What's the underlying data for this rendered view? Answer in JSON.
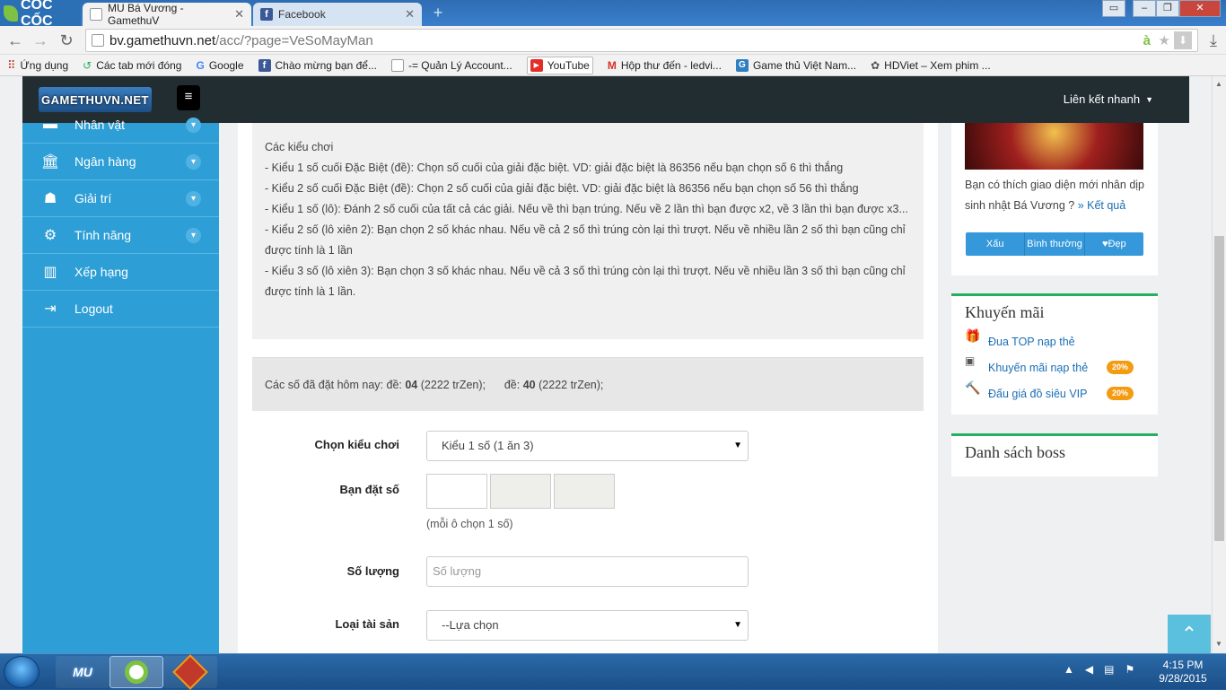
{
  "browser": {
    "brand": "CỐC CỐC",
    "tabs": [
      {
        "title": "MU Bá Vương - GamethuV",
        "active": true
      },
      {
        "title": "Facebook",
        "active": false
      }
    ],
    "url": {
      "host": "bv.gamethuvn.net",
      "path": "/acc/?page=VeSoMayMan"
    },
    "bookmarks": [
      {
        "label": "Ứng dụng",
        "icon": "apps-grid-icon"
      },
      {
        "label": "Các tab mới đóng",
        "icon": "recent-tabs-icon"
      },
      {
        "label": "Google",
        "icon": "google-icon"
      },
      {
        "label": "Chào mừng bạn để...",
        "icon": "facebook-icon"
      },
      {
        "label": "-= Quản Lý Account...",
        "icon": "page-icon"
      },
      {
        "label": "YouTube",
        "icon": "youtube-icon"
      },
      {
        "label": "Hộp thư đến - ledvi...",
        "icon": "gmail-icon"
      },
      {
        "label": "Game thủ Việt Nam...",
        "icon": "gamethu-icon"
      },
      {
        "label": "HDViet – Xem phim ...",
        "icon": "hdviet-icon"
      }
    ]
  },
  "site": {
    "logo": "GAMETHUVN.NET",
    "quick_links": "Liên kết nhanh",
    "sidebar": [
      {
        "label": "Nhân vật",
        "icon": "character-icon",
        "chevron": true
      },
      {
        "label": "Ngân hàng",
        "icon": "bank-icon",
        "chevron": true
      },
      {
        "label": "Giải trí",
        "icon": "android-icon",
        "chevron": true
      },
      {
        "label": "Tính năng",
        "icon": "cogs-icon",
        "chevron": true
      },
      {
        "label": "Xếp hạng",
        "icon": "bar-chart-icon",
        "chevron": false
      },
      {
        "label": "Logout",
        "icon": "logout-icon",
        "chevron": false
      }
    ],
    "rules": {
      "heading": "Các kiểu chơi",
      "lines": [
        "- Kiểu 1 số cuối Đặc Biệt (đề): Chọn số cuối của giải đặc biệt. VD: giải đặc biệt là 86356 nếu bạn chọn số 6 thì thắng",
        "- Kiểu 2 số cuối Đặc Biệt (đề): Chọn 2 số cuối của giải đặc biệt. VD: giải đặc biệt là 86356 nếu bạn chọn số 56 thì thắng",
        "- Kiểu 1 số (lô): Đánh 2 số cuối của tất cả các giải. Nếu về thì bạn trúng. Nếu về 2 lần thì bạn được x2, về 3 lần thì bạn được x3...",
        "- Kiểu 2 số (lô xiên 2): Bạn chọn 2 số khác nhau. Nếu về cả 2 số thì trúng còn lại thì trượt. Nếu về nhiều lần 2 số thì bạn cũng chỉ được tính là 1 lần",
        "- Kiểu 3 số (lô xiên 3): Bạn chọn 3 số khác nhau. Nếu về cả 3 số thì trúng còn lại thì trượt. Nếu về nhiều lần 3 số thì bạn cũng chỉ được tính là 1 lần."
      ]
    },
    "today": {
      "prefix": "Các số đã đặt hôm nay: đề:",
      "num1": "04",
      "amount1": "(2222 trZen);",
      "label2": "đề:",
      "num2": "40",
      "amount2": "(2222 trZen);"
    },
    "form": {
      "play_type_label": "Chọn kiểu chơi",
      "play_type_value": "Kiểu 1 số (1 ăn 3)",
      "number_label": "Bạn đặt số",
      "number_hint": "(mỗi ô chọn 1 số)",
      "quantity_label": "Số lượng",
      "quantity_placeholder": "Số lượng",
      "asset_label": "Loại tài sản",
      "asset_value": "--Lựa chọn"
    },
    "poll": {
      "question": "Bạn có thích giao diện mới nhân dịp sinh nhật Bá Vương ?",
      "result_link": "» Kết quả",
      "options": [
        "Xấu",
        "Bình thường",
        "Đẹp"
      ]
    },
    "promo": {
      "title": "Khuyến mãi",
      "items": [
        {
          "label": "Đua TOP nạp thẻ",
          "icon": "gift-icon",
          "badge": ""
        },
        {
          "label": "Khuyến mãi nạp thẻ",
          "icon": "money-icon",
          "badge": "20%"
        },
        {
          "label": "Đấu giá đồ siêu VIP",
          "icon": "gavel-icon",
          "badge": "20%"
        }
      ]
    },
    "boss": {
      "title": "Danh sách boss"
    }
  },
  "taskbar": {
    "time": "4:15 PM",
    "date": "9/28/2015",
    "apps": [
      "MU",
      "Cốc Cốc",
      "Game"
    ]
  },
  "colors": {
    "sidebar": "#2e9fd6",
    "topbar": "#222d32",
    "accent_green": "#27ae60",
    "badge": "#f39c12",
    "poll_button": "#3498db"
  }
}
